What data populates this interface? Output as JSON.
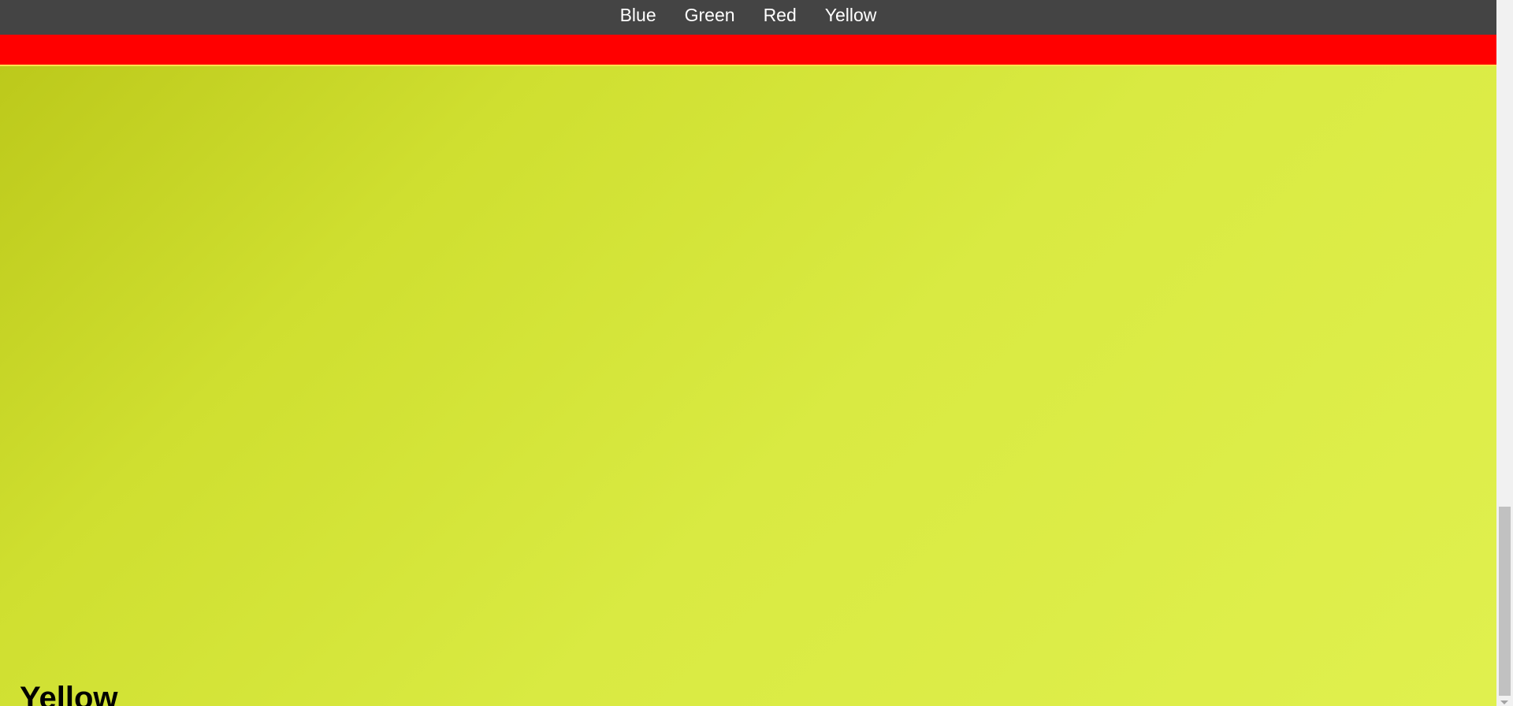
{
  "nav": {
    "links": [
      {
        "label": "Blue"
      },
      {
        "label": "Green"
      },
      {
        "label": "Red"
      },
      {
        "label": "Yellow"
      }
    ]
  },
  "sections": {
    "yellow_heading": "Yellow"
  },
  "colors": {
    "navbar": "#444444",
    "red_section": "#ff0000",
    "yellow_section": "#d9ea42"
  }
}
